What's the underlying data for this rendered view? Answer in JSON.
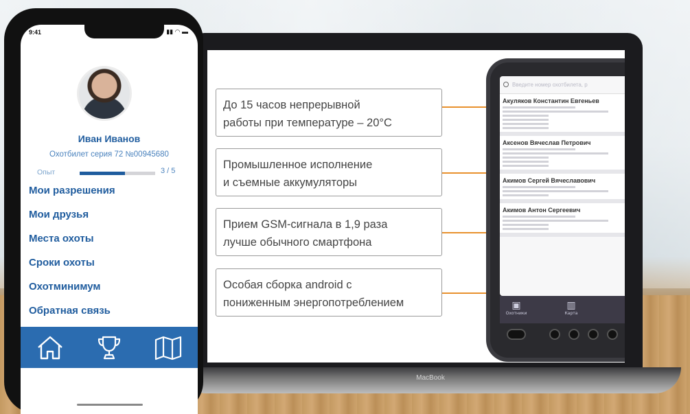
{
  "phone": {
    "status_time": "9:41",
    "status_icons": "▮▮ ◠ ▬",
    "user": {
      "name": "Иван Иванов",
      "license": "Охотбилет серия 72 №00945680",
      "experience_label": "Опыт",
      "experience_count": "3 / 5",
      "experience_fraction": 0.6
    },
    "menu": [
      {
        "label": "Мои разрешения"
      },
      {
        "label": "Мои друзья"
      },
      {
        "label": "Места охоты"
      },
      {
        "label": "Сроки охоты"
      },
      {
        "label": "Охотминимум"
      },
      {
        "label": "Обратная связь"
      }
    ],
    "tabbar": [
      {
        "icon": "home-icon"
      },
      {
        "icon": "trophy-icon"
      },
      {
        "icon": "map-icon"
      }
    ],
    "colors": {
      "accent": "#1f5c9e",
      "tabbar": "#2b6cb0"
    }
  },
  "laptop": {
    "brand": "MacBook",
    "features": [
      {
        "line1": "До 15 часов непрерывной",
        "line2": "работы при температуре – 20°C"
      },
      {
        "line1": "Промышленное исполнение",
        "line2": "и съемные аккумуляторы"
      },
      {
        "line1": "Прием GSM-сигнала в 1,9 раза",
        "line2": "лучше обычного смартфона"
      },
      {
        "line1": "Особая сборка android с",
        "line2": "пониженным энергопотреблением"
      }
    ],
    "connector_color": "#e8902c"
  },
  "tablet": {
    "search_placeholder": "Введите номер охотбилета, р",
    "cards": [
      {
        "name": "Акуляков Константин Евгеньев"
      },
      {
        "name": "Аксенов Вячеслав Петрович"
      },
      {
        "name": "Акимов Сергей Вячеславович"
      },
      {
        "name": "Акимов Антон Сергеевич"
      }
    ],
    "nav": [
      {
        "label": "Охотники",
        "icon": "person-icon"
      },
      {
        "label": "Карта",
        "icon": "map-icon"
      }
    ]
  }
}
